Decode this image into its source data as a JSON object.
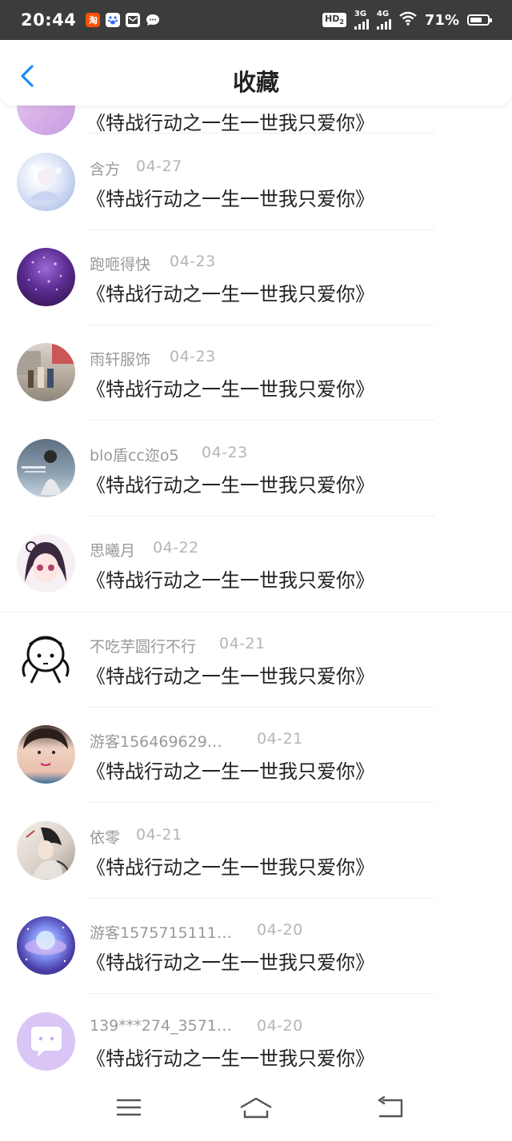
{
  "status_bar": {
    "time": "20:44",
    "app_icons": [
      {
        "name": "taobao-icon",
        "label": "淘",
        "color": "#ff5000"
      },
      {
        "name": "baidu-paw-icon",
        "label": "",
        "color": "#2f6af5"
      },
      {
        "name": "mail-icon",
        "label": "",
        "color": "#ffffff"
      },
      {
        "name": "chat-bubble-icon",
        "label": "",
        "color": "#ffffff"
      }
    ],
    "hd_label": "HD",
    "hd_sub": "2",
    "net1": "3G",
    "net2": "4G",
    "battery_percent": "71%",
    "battery_level": 0.71
  },
  "nav": {
    "title": "收藏",
    "back_color": "#1d8cf8"
  },
  "items": [
    {
      "user": "含方",
      "date": "04-27",
      "title": "《特战行动之一生一世我只爱你》",
      "avatar": "anime-lace-avatar"
    },
    {
      "user": "跑咂得快",
      "date": "04-23",
      "title": "《特战行动之一生一世我只爱你》",
      "avatar": "purple-glitter-avatar"
    },
    {
      "user": "雨轩服饰",
      "date": "04-23",
      "title": "《特战行动之一生一世我只爱你》",
      "avatar": "street-photo-avatar"
    },
    {
      "user": "blo盾cc迩o5",
      "date": "04-23",
      "title": "《特战行动之一生一世我只爱你》",
      "avatar": "girl-text-avatar"
    },
    {
      "user": "思曦月",
      "date": "04-22",
      "title": "《特战行动之一生一世我只爱你》",
      "avatar": "anime-girl-avatar"
    },
    {
      "user": "不吃芋圆行不行",
      "date": "04-21",
      "title": "《特战行动之一生一世我只爱你》",
      "avatar": "doodle-face-avatar"
    },
    {
      "user": "游客156469629…",
      "date": "04-21",
      "title": "《特战行动之一生一世我只爱你》",
      "avatar": "selfie-avatar"
    },
    {
      "user": "依零",
      "date": "04-21",
      "title": "《特战行动之一生一世我只爱你》",
      "avatar": "ink-painting-avatar"
    },
    {
      "user": "游客1575715111…",
      "date": "04-20",
      "title": "《特战行动之一生一世我只爱你》",
      "avatar": "galaxy-avatar"
    },
    {
      "user": "139***274_3571…",
      "date": "04-20",
      "title": "《特战行动之一生一世我只爱你》",
      "avatar": "default-chat-avatar"
    }
  ]
}
